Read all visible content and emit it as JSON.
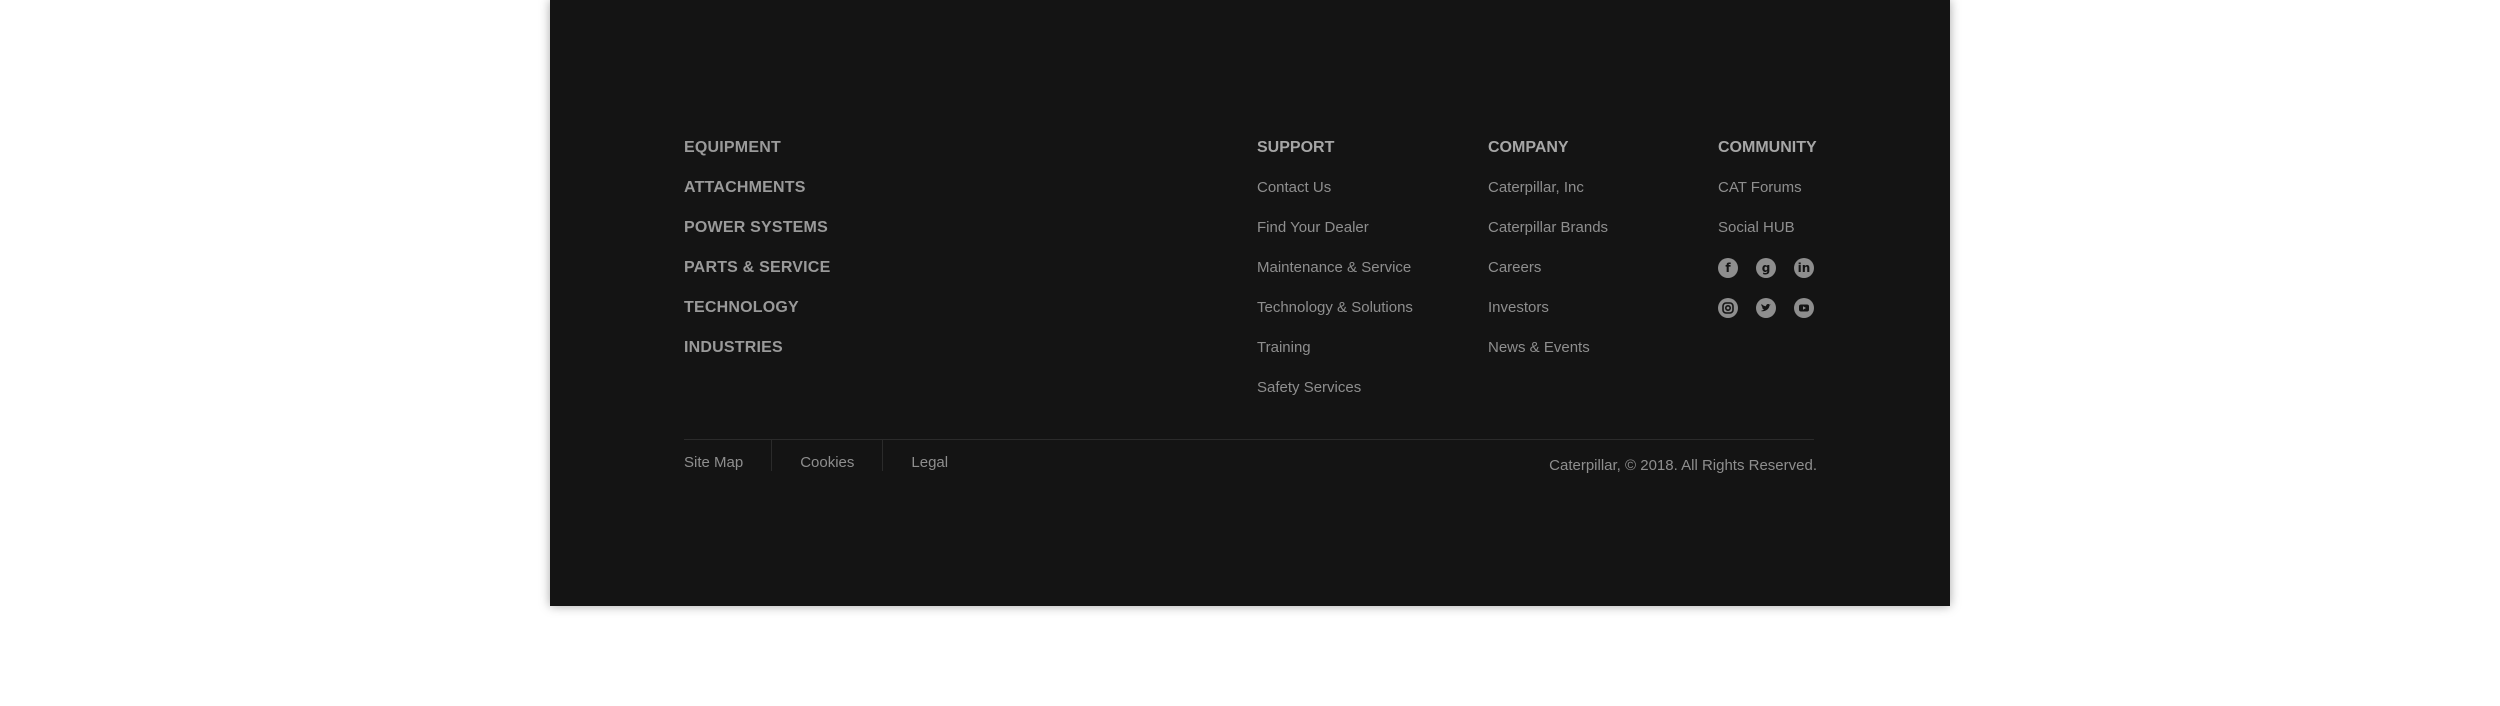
{
  "primary_nav": {
    "items": [
      "EQUIPMENT",
      "ATTACHMENTS",
      "POWER SYSTEMS",
      "PARTS & SERVICE",
      "TECHNOLOGY",
      "INDUSTRIES"
    ]
  },
  "support": {
    "heading": "SUPPORT",
    "links": [
      "Contact Us",
      "Find Your Dealer",
      "Maintenance & Service",
      "Technology & Solutions",
      "Training",
      "Safety Services"
    ]
  },
  "company": {
    "heading": "COMPANY",
    "links": [
      "Caterpillar, Inc",
      "Caterpillar Brands",
      "Careers",
      "Investors",
      "News & Events"
    ]
  },
  "community": {
    "heading": "COMMUNITY",
    "links": [
      "CAT Forums",
      "Social HUB"
    ],
    "social_icons": [
      "facebook-icon",
      "google-plus-icon",
      "linkedin-icon",
      "instagram-icon",
      "twitter-icon",
      "youtube-icon"
    ]
  },
  "bottom": {
    "links": [
      "Site Map",
      "Cookies",
      "Legal"
    ],
    "copyright": "Caterpillar, © 2018. All Rights Reserved."
  },
  "colors": {
    "footer_bg": "#141414",
    "text": "#8e8e8e",
    "heading": "#a6a6a6"
  }
}
